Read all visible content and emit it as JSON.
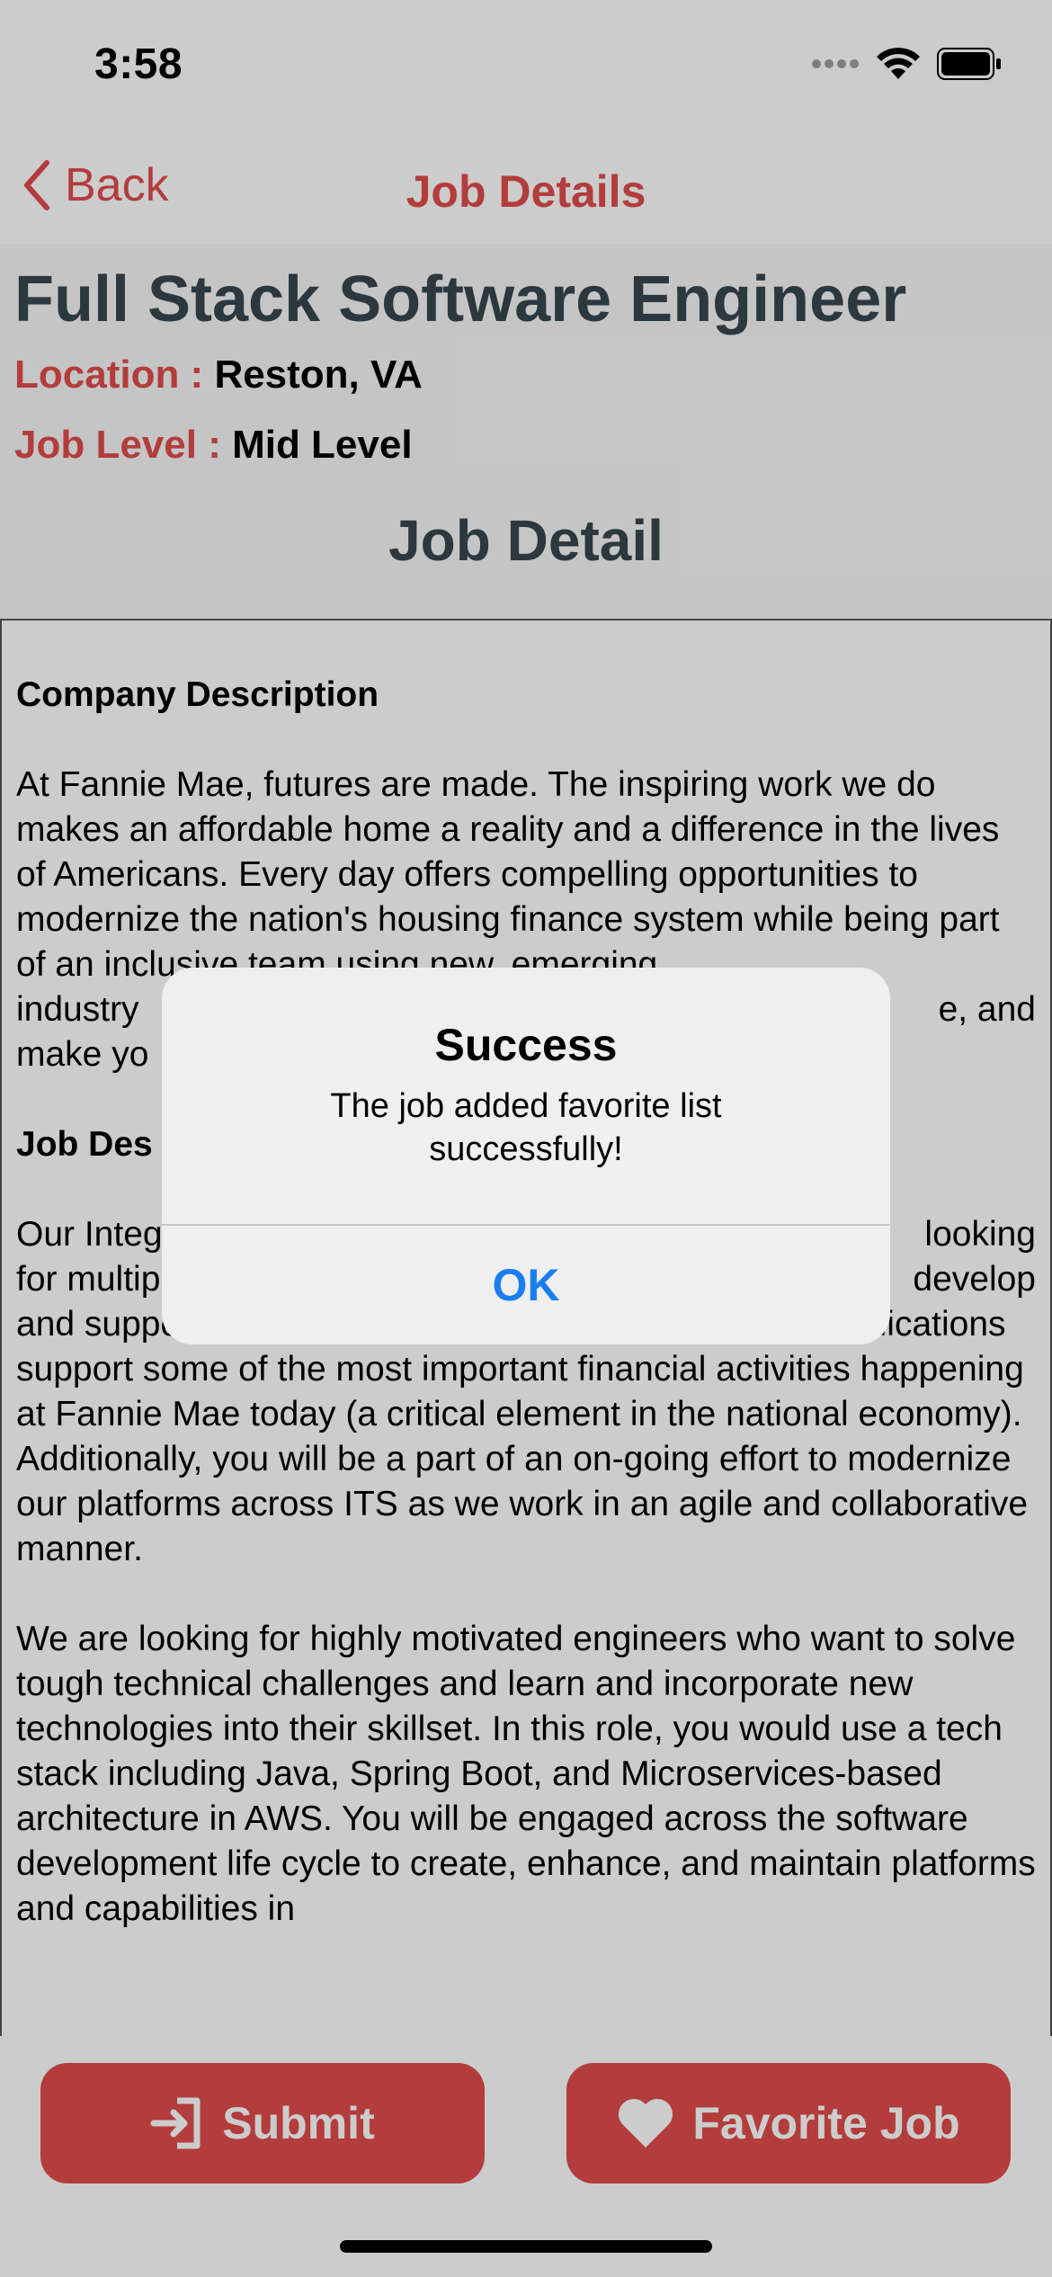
{
  "status_bar": {
    "time": "3:58"
  },
  "nav": {
    "back_label": "Back",
    "title": "Job Details"
  },
  "job": {
    "title": "Full Stack Software Engineer",
    "location_label": "Location : ",
    "location_value": "Reston, VA",
    "level_label": "Job Level : ",
    "level_value": "Mid Level",
    "section_title": "Job Detail"
  },
  "description": {
    "company_heading": "Company Description",
    "company_text": "At Fannie Mae, futures are made. The inspiring work we do makes an affordable home a reality and a difference in the lives of Americans. Every day offers compelling opportunities to modernize the nation's housing finance system while being part of an inclusive team using new, emerging",
    "company_text_2": "industry",
    "company_text_3": "e, and",
    "company_text_4": "make yo",
    "job_heading": "Job Des",
    "para1": "Our Integ",
    "para1_right": "looking",
    "para1_line2_left": "for multip",
    "para1_line2_right": "develop",
    "para1_rest": "and support our mission critical applications. These applications support some of the most important financial activities happening at Fannie Mae today (a critical element in the national economy). Additionally, you will be a part of an on-going effort to modernize our platforms across ITS as we work in an agile and collaborative manner.",
    "para2": "We are looking for highly motivated engineers who want to solve tough technical challenges and learn and incorporate new technologies into their skillset. In this role, you would use a tech stack including Java, Spring Boot, and Microservices-based architecture in AWS. You will be engaged across the software development life cycle to create, enhance, and maintain platforms and capabilities in"
  },
  "buttons": {
    "submit": "Submit",
    "favorite": "Favorite Job"
  },
  "alert": {
    "title": "Success",
    "message": "The job added favorite list successfully!",
    "ok": "OK"
  },
  "colors": {
    "accent": "#e04b4b",
    "title_gray": "#37474f",
    "link_blue": "#1a7ef2"
  }
}
